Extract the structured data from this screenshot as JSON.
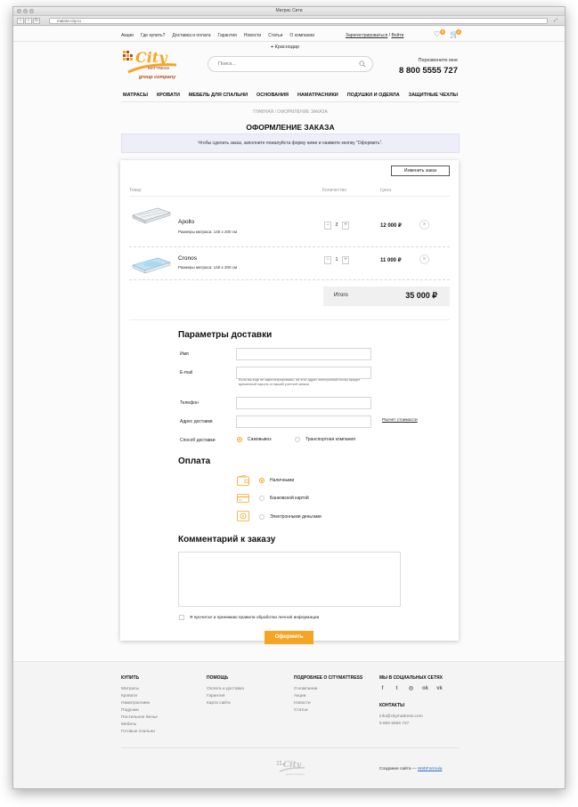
{
  "browser": {
    "title": "Матрас Сити",
    "url": "matras-city.ru"
  },
  "topnav": {
    "links": [
      "Акции",
      "Где купить?",
      "Доставка и оплата",
      "Гарантия",
      "Новости",
      "Статьи",
      "О компании"
    ],
    "register": "Зарегистрироваться",
    "separator": "/",
    "login": "Войти",
    "favorites_count": "0",
    "cart_count": "2"
  },
  "header": {
    "logo_text": "City",
    "logo_sub": "MATTRESS",
    "logo_company": "group company",
    "city": "Краснодар",
    "search_placeholder": "Поиск...",
    "callme": "Перезвоните мне",
    "phone": "8 800 5555 727"
  },
  "mainnav": [
    "Матрасы",
    "Кровати",
    "Мебель для спальни",
    "Основания",
    "Наматрасники",
    "Подушки и одеяла",
    "Защитные чехлы"
  ],
  "breadcrumb": "Главная / Оформление заказа",
  "page_title": "Оформление заказа",
  "notice": "Чтобы сделать заказ, заполните пожалуйста форму ниже и нажмите кнопку \"Оформить\".",
  "order": {
    "change_button": "Изменить заказ",
    "columns": {
      "product": "Товар",
      "quantity": "Количество",
      "price": "Цена"
    },
    "items": [
      {
        "name": "Apollo",
        "size": "Размеры матраса: 140 x 200 см",
        "qty": "2",
        "price": "12 000 ₽"
      },
      {
        "name": "Cronos",
        "size": "Размеры матраса: 140 x 200 см",
        "qty": "1",
        "price": "11 000 ₽"
      }
    ],
    "total_label": "Итого",
    "total_value": "35 000 ₽"
  },
  "delivery": {
    "title": "Параметры доставки",
    "name_label": "Имя",
    "email_label": "E-mail",
    "email_note": "Если вы еще не зарегистрированы, на этот адрес электронной почты придет временный пароль от вашей учетной записи",
    "phone_label": "Телефон",
    "address_label": "Адрес доставки",
    "calc_link": "Расчет стоимости",
    "method_label": "Способ доставки",
    "methods": [
      "Самовывоз",
      "Транспортная компания"
    ]
  },
  "payment": {
    "title": "Оплата",
    "options": [
      "Наличными",
      "Банковской картой",
      "Электронными деньгами"
    ]
  },
  "comment": {
    "title": "Комментарий к заказу"
  },
  "agree_text": "Я прочитал и принимаю правила обработки личной информации",
  "submit_label": "Оформить",
  "footer": {
    "buy": {
      "title": "Купить",
      "items": [
        "Матрасы",
        "Кровати",
        "Наматрасники",
        "Подушки",
        "Постельное белье",
        "Мебель",
        "Готовые спальни"
      ]
    },
    "help": {
      "title": "Помощь",
      "items": [
        "Оплата и доставка",
        "Гарантия",
        "Карта сайта"
      ]
    },
    "about": {
      "title": "Подробнее о CITYMATTRESS",
      "items": [
        "О компании",
        "Акции",
        "Новости",
        "Статьи"
      ]
    },
    "social": {
      "title": "Мы в социальных сетях",
      "icons": [
        "facebook-icon",
        "twitter-icon",
        "instagram-icon",
        "odnoklassniki-icon",
        "vk-icon"
      ]
    },
    "contacts": {
      "title": "Контакты",
      "email": "info@citymattress.com",
      "phone": "8 800 5555 727"
    },
    "made_by_prefix": "Создание сайта —",
    "made_by_link": "WebFormula"
  },
  "colors": {
    "accent": "#f5a523",
    "notice_bg": "#eeeef9"
  }
}
